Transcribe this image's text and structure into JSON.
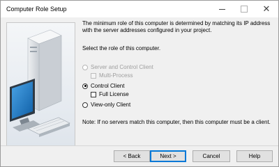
{
  "window": {
    "title": "Computer Role Setup",
    "controls": {
      "minimize_icon": "minimize-icon",
      "maximize_icon": "maximize-icon",
      "close_icon": "close-icon"
    }
  },
  "illustration": {
    "icon": "computer-illustration",
    "colors": {
      "tower": "#d9dde2",
      "screen": "#1f7fc4",
      "background": "#e6ecf2"
    }
  },
  "description": "The minimum role of this computer is determined by matching its IP address with the server addresses configured in your project.",
  "prompt": "Select the role of this computer.",
  "roles": {
    "server": {
      "label": "Server and Control Client",
      "selected": false,
      "enabled": false
    },
    "multi_process": {
      "label": "Multi-Process",
      "checked": false,
      "enabled": false
    },
    "control": {
      "label": "Control Client",
      "selected": true,
      "enabled": true
    },
    "full_license": {
      "label": "Full License",
      "checked": false,
      "enabled": true
    },
    "view_only": {
      "label": "View-only Client",
      "selected": false,
      "enabled": true
    }
  },
  "note": "Note: If no servers match this computer, then this computer must be a client.",
  "buttons": {
    "back": "< Back",
    "next": "Next >",
    "cancel": "Cancel",
    "help": "Help"
  }
}
